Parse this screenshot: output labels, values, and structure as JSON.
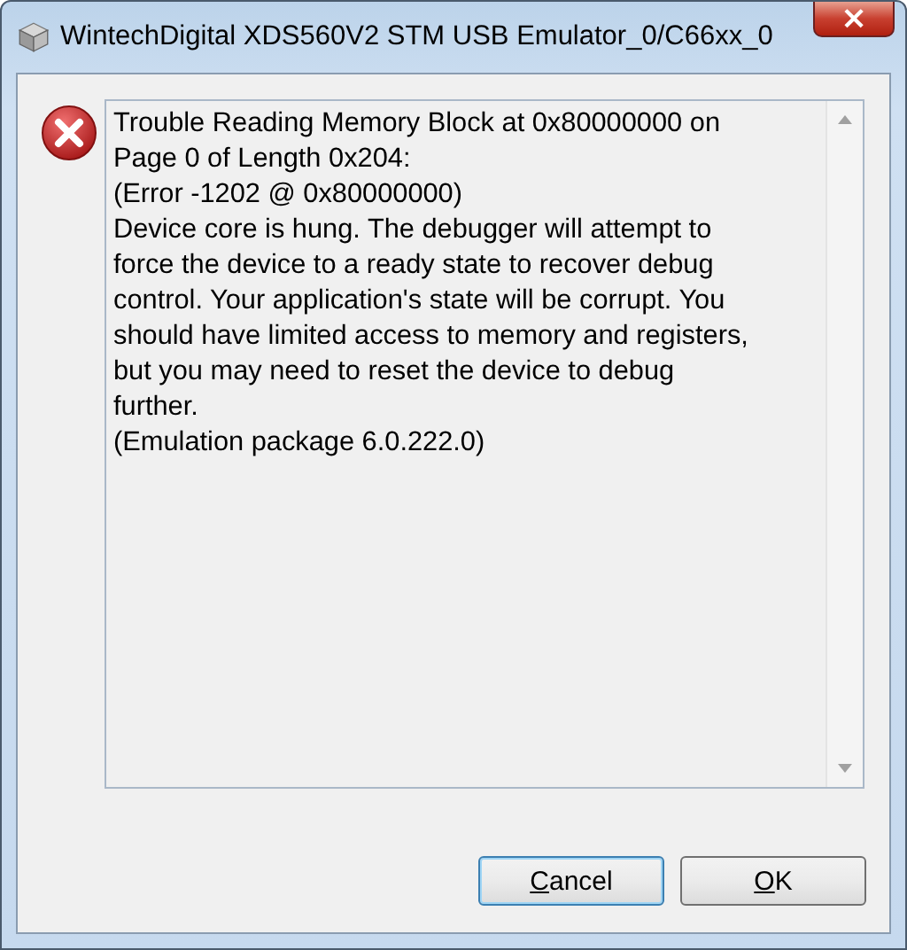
{
  "window": {
    "title": "WintechDigital XDS560V2 STM USB Emulator_0/C66xx_0",
    "close_symbol": "×"
  },
  "message": {
    "kind": "error",
    "lines": [
      "Trouble Reading Memory Block at 0x80000000 on",
      "Page 0 of Length 0x204:",
      "(Error -1202 @ 0x80000000)",
      "Device core is hung. The debugger will attempt to",
      "force the device to a ready state to recover debug",
      "control. Your application's state will be corrupt. You",
      "should have limited access to memory and registers,",
      "but you may need to reset the device to debug",
      "further.",
      "(Emulation package 6.0.222.0)"
    ]
  },
  "buttons": [
    {
      "label": "Cancel",
      "default": true,
      "underline_first": true
    },
    {
      "label": "OK",
      "default": false,
      "underline_first": true
    }
  ]
}
